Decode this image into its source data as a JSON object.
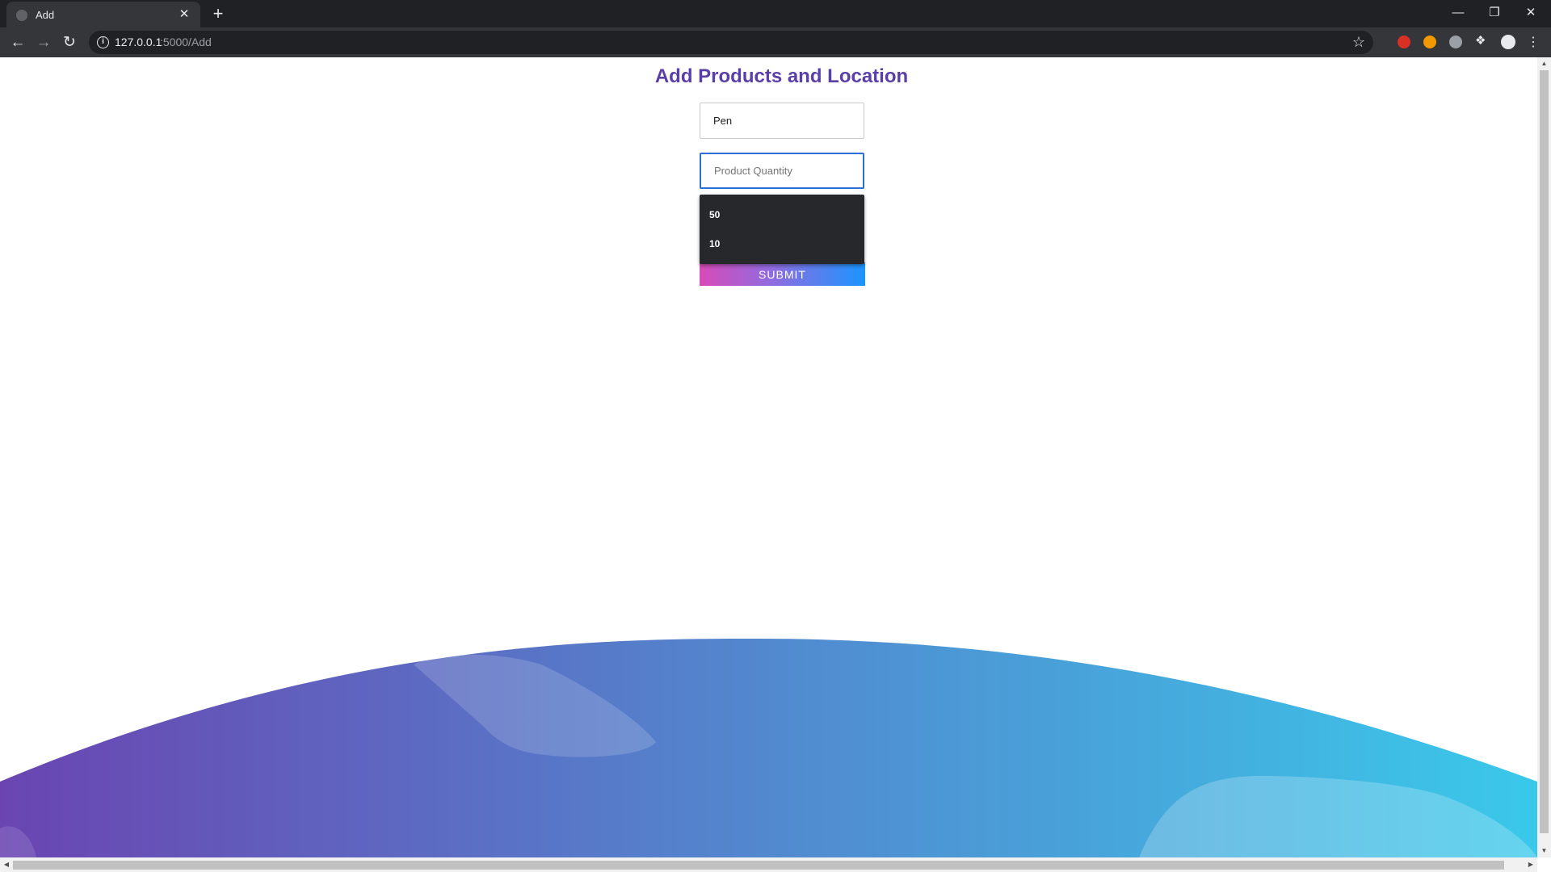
{
  "browser": {
    "tab_title": "Add",
    "close_tab_symbol": "✕",
    "new_tab_symbol": "+",
    "url_host": "127.0.0.1",
    "url_path": ":5000/Add"
  },
  "form": {
    "title": "Add Products and Location",
    "product_name_value": "Pen",
    "quantity_placeholder": "Product Quantity",
    "quantity_value": "",
    "autocomplete_options": [
      "50",
      "10"
    ],
    "submit_label": "SUBMIT"
  },
  "colors": {
    "title": "#5a3fa8",
    "wave_left": "#6a45b2",
    "wave_right": "#3ac9ea",
    "focus_border": "#2b6fd6"
  }
}
